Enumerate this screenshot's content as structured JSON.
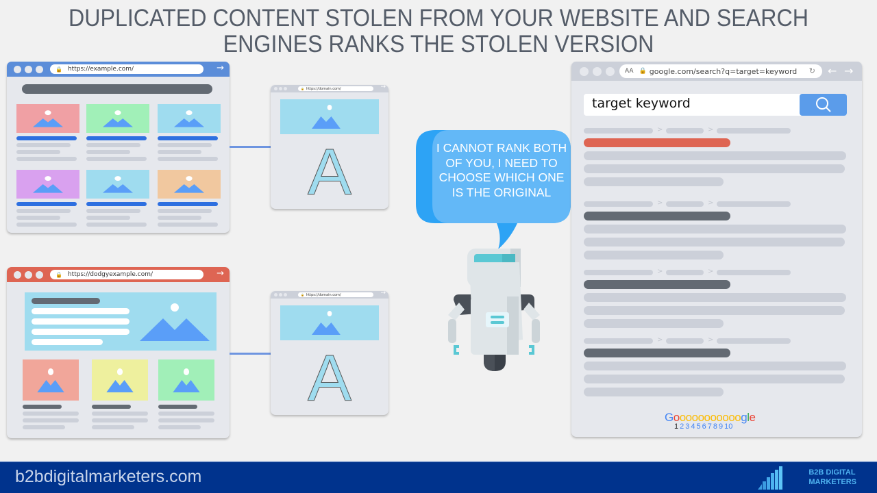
{
  "title": {
    "line1": "DUPLICATED CONTENT STOLEN FROM YOUR WEBSITE AND SEARCH",
    "line2": "ENGINES RANKS THE STOLEN VERSION"
  },
  "original_site": {
    "url": "https://example.com/",
    "accent": "#5b8dd9",
    "card_colors": [
      "#f0a0a4",
      "#a1f0b8",
      "#9fdcef",
      "#d9a1ef",
      "#9fdcef",
      "#f1c89f"
    ]
  },
  "stolen_site": {
    "url": "https://dodgyexample.com/",
    "accent": "#de6553",
    "card_colors": [
      "#f1a69a",
      "#eef09e",
      "#a1efb8"
    ]
  },
  "duplicate_pages": [
    {
      "url": "https://domain.com/",
      "letter": "A"
    },
    {
      "url": "https://domain.com/",
      "letter": "A"
    }
  ],
  "bot_speech": "I CANNOT RANK BOTH OF YOU, I NEED TO CHOOSE WHICH ONE IS THE ORIGINAL",
  "search_browser": {
    "text_size_label": "AA",
    "url": "google.com/search?q=target=keyword",
    "search_query": "target keyword",
    "highlight_color": "#de6553",
    "pagination_logo": {
      "G": "G",
      "o_red": "o",
      "o_yellow": "oooooooooo",
      "g": "g",
      "l": "l",
      "e": "e"
    },
    "pages": [
      "1",
      "2",
      "3",
      "4",
      "5",
      "6",
      "7",
      "8",
      "9",
      "10"
    ]
  },
  "footer": {
    "website": "b2bdigitalmarketers.com",
    "brand_line1": "B2B DIGITAL",
    "brand_line2": "MARKETERS"
  }
}
